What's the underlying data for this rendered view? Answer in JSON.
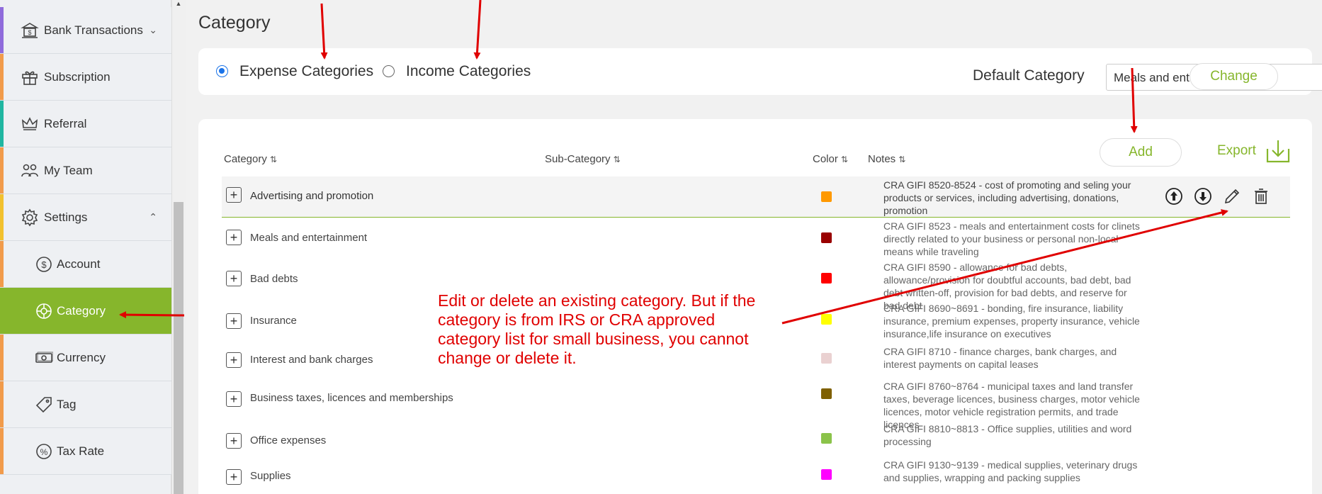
{
  "sidebar": {
    "items": [
      {
        "label": "Bank Transactions",
        "icon": "bank-icon",
        "stripe": "#8f6bdb"
      },
      {
        "label": "Subscription",
        "icon": "gift-icon",
        "stripe": "#f19b4b"
      },
      {
        "label": "Referral",
        "icon": "crown-icon",
        "stripe": "#20b6a1"
      },
      {
        "label": "My Team",
        "icon": "team-icon",
        "stripe": "#f19b4b"
      },
      {
        "label": "Settings",
        "icon": "gear-icon",
        "stripe": "#f2c12e"
      }
    ],
    "sub_items": [
      {
        "label": "Account",
        "icon": "dollar-circle-icon"
      },
      {
        "label": "Category",
        "icon": "category-icon"
      },
      {
        "label": "Currency",
        "icon": "currency-icon"
      },
      {
        "label": "Tag",
        "icon": "tag-icon"
      },
      {
        "label": "Tax Rate",
        "icon": "percent-icon"
      }
    ],
    "accent": "#86b62c"
  },
  "page": {
    "title": "Category"
  },
  "filters": {
    "expense_label": "Expense Categories",
    "income_label": "Income Categories",
    "default_label": "Default Category",
    "default_value": "Meals and entertainment",
    "change_label": "Change"
  },
  "table": {
    "headers": {
      "category": "Category",
      "subcategory": "Sub-Category",
      "color": "Color",
      "notes": "Notes"
    },
    "add_label": "Add",
    "export_label": "Export",
    "rows": [
      {
        "category": "Advertising and promotion",
        "color": "#ff9900",
        "notes": "CRA GIFI 8520-8524 - cost of promoting and seling your products or services, including advertising, donations, promotion"
      },
      {
        "category": "Meals and entertainment",
        "color": "#990000",
        "notes": "CRA GIFI 8523 - meals and entertainment costs for clinets directly related to your business or personal non-local means while traveling"
      },
      {
        "category": "Bad debts",
        "color": "#ff0000",
        "notes": "CRA GIFI 8590 - allowance for bad debts, allowance/provision for doubtful accounts, bad debt, bad debt written-off, provision for bad debts, and reserve for bad debt"
      },
      {
        "category": "Insurance",
        "color": "#ffff00",
        "notes": "CRA GIFI 8690~8691 - bonding, fire insurance, liability insurance, premium expenses, property insurance, vehicle insurance,life insurance on executives"
      },
      {
        "category": "Interest and bank charges",
        "color": "#ead1d1",
        "notes": "CRA GIFI 8710 - finance charges, bank charges, and interest payments on capital leases"
      },
      {
        "category": "Business taxes, licences and memberships",
        "color": "#7f6000",
        "notes": "CRA GIFI 8760~8764 - municipal taxes and land transfer taxes, beverage licences, business charges, motor vehicle licences, motor vehicle registration permits, and trade licences"
      },
      {
        "category": "Office expenses",
        "color": "#8bc34a",
        "notes": "CRA GIFI 8810~8813 - Office supplies, utilities and word processing"
      },
      {
        "category": "Supplies",
        "color": "#ff00ff",
        "notes": "CRA GIFI 9130~9139 - medical supplies, veterinary drugs and supplies, wrapping and packing supplies"
      }
    ]
  },
  "annotation": {
    "text": "Edit or delete an existing category.  But if the category is from IRS or CRA approved category list for small business, you cannot change or delete it.",
    "color": "#e00000"
  }
}
